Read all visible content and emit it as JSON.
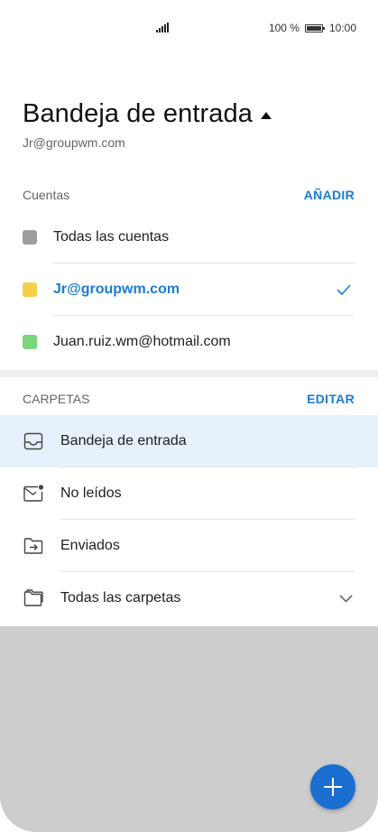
{
  "status_bar": {
    "battery_percent": "100 %",
    "time": "10:00"
  },
  "header": {
    "title": "Bandeja de entrada",
    "subtitle": "Jr@groupwm.com"
  },
  "accounts": {
    "label": "Cuentas",
    "action": "AÑADIR",
    "items": [
      {
        "label": "Todas las cuentas",
        "color": "#9e9e9e",
        "active": false
      },
      {
        "label": "Jr@groupwm.com",
        "color": "#f5cf4a",
        "active": true
      },
      {
        "label": "Juan.ruiz.wm@hotmail.com",
        "color": "#7bd67b",
        "active": false
      }
    ]
  },
  "folders": {
    "label": "CARPETAS",
    "action": "EDITAR",
    "items": [
      {
        "label": "Bandeja de entrada",
        "icon": "inbox-icon",
        "selected": true
      },
      {
        "label": "No leídos",
        "icon": "unread-mail-icon",
        "selected": false
      },
      {
        "label": "Enviados",
        "icon": "sent-folder-icon",
        "selected": false
      },
      {
        "label": "Todas las carpetas",
        "icon": "folders-icon",
        "selected": false
      }
    ]
  },
  "colors": {
    "accent": "#1a7bd6",
    "selected_row": "#e6f1fc",
    "fab": "#1a6fd1"
  }
}
